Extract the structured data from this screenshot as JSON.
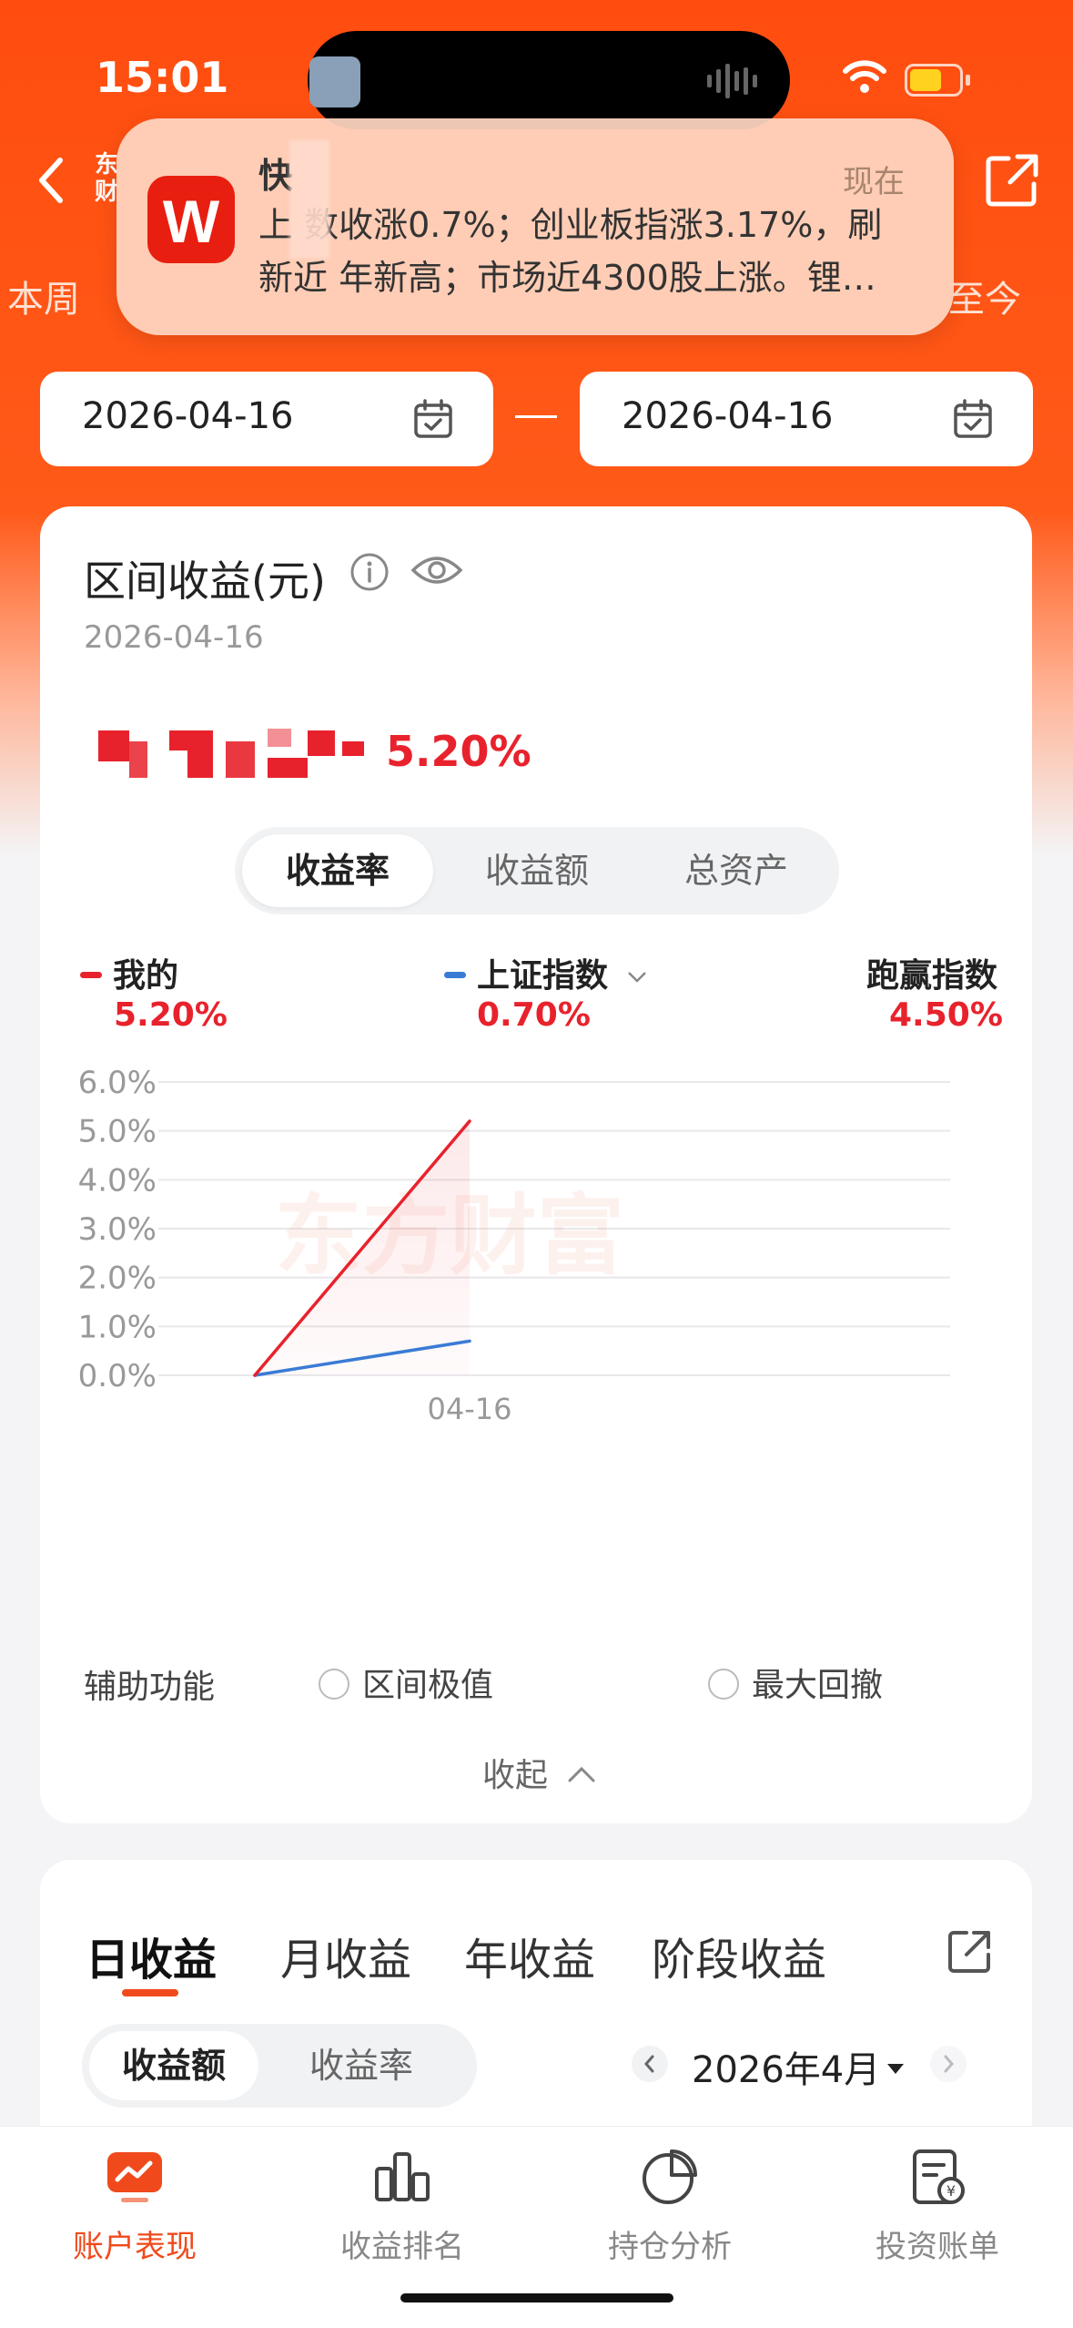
{
  "status_bar": {
    "time": "15:01"
  },
  "header": {
    "title_chars": "东财",
    "period_left": "本周",
    "period_right": "至今"
  },
  "notification": {
    "app_icon_letter": "W",
    "title": "快",
    "time": "现在",
    "body": "上 数收涨0.7%；创业板指涨3.17%，刷新近 年新高；市场近4300股上涨。锂…"
  },
  "date_range": {
    "start": "2026-04-16",
    "end": "2026-04-16"
  },
  "summary": {
    "title": "区间收益(元)",
    "date": "2026-04-16",
    "percent": "5.20%"
  },
  "tabs": [
    "收益率",
    "收益额",
    "总资产"
  ],
  "legend": [
    {
      "name": "我的",
      "value": "5.20%",
      "color": "#e8222c"
    },
    {
      "name": "上证指数",
      "value": "0.70%",
      "color": "#3a7bd5"
    },
    {
      "name": "跑赢指数",
      "value": "4.50%"
    }
  ],
  "chart_data": {
    "type": "line",
    "x": [
      "",
      "04-16"
    ],
    "series": [
      {
        "name": "我的",
        "values": [
          0.0,
          5.2
        ],
        "color": "#e8222c"
      },
      {
        "name": "上证指数",
        "values": [
          0.0,
          0.7
        ],
        "color": "#3a7bd5"
      }
    ],
    "yticks": [
      "6.0%",
      "5.0%",
      "4.0%",
      "3.0%",
      "2.0%",
      "1.0%",
      "0.0%"
    ],
    "xtick_labels": [
      "04-16"
    ],
    "ylim": [
      0,
      6
    ],
    "grid": true,
    "watermark": "东方财富"
  },
  "aux": {
    "label": "辅助功能",
    "option1": "区间极值",
    "option2": "最大回撤",
    "collapse": "收起"
  },
  "returns": {
    "tabs": [
      "日收益",
      "月收益",
      "年收益",
      "阶段收益"
    ],
    "seg": [
      "收益额",
      "收益率"
    ],
    "month": "2026年4月"
  },
  "bottom_nav": [
    {
      "label": "账户表现",
      "icon": "chart-screen-icon",
      "active": true
    },
    {
      "label": "收益排名",
      "icon": "bar-chart-icon",
      "active": false
    },
    {
      "label": "持仓分析",
      "icon": "pie-chart-icon",
      "active": false
    },
    {
      "label": "投资账单",
      "icon": "bill-icon",
      "active": false
    }
  ]
}
